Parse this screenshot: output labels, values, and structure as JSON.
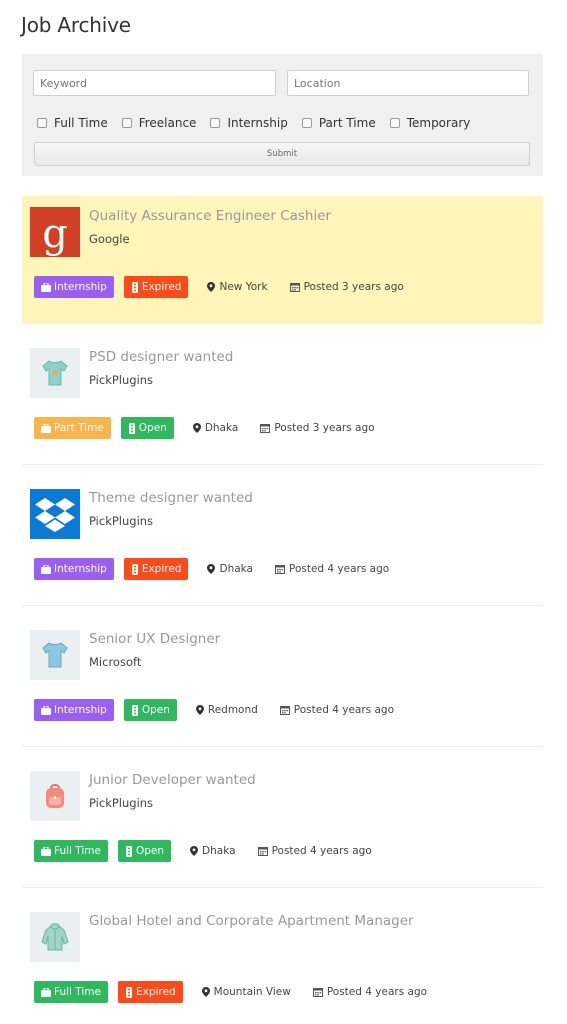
{
  "page": {
    "title": "Job Archive"
  },
  "filters": {
    "keyword_placeholder": "Keyword",
    "location_placeholder": "Location",
    "job_types": [
      "Full Time",
      "Freelance",
      "Internship",
      "Part Time",
      "Temporary"
    ],
    "submit_label": "Submit"
  },
  "colors": {
    "full_time": "#2fb85e",
    "internship": "#9b5ef2",
    "part_time": "#f7b54a",
    "open": "#2fb85e",
    "expired": "#fc4b19",
    "featured_bg": "#fdf5b9"
  },
  "jobs": [
    {
      "title": "Quality Assurance Engineer Cashier",
      "company": "Google",
      "type": "Internship",
      "status": "Expired",
      "location": "New York",
      "posted": "Posted 3 years ago",
      "featured": true,
      "logo": "google-logo"
    },
    {
      "title": "PSD designer wanted",
      "company": "PickPlugins",
      "type": "Part Time",
      "status": "Open",
      "location": "Dhaka",
      "posted": "Posted 3 years ago",
      "featured": false,
      "logo": "tshirt-logo"
    },
    {
      "title": "Theme designer wanted",
      "company": "PickPlugins",
      "type": "Internship",
      "status": "Expired",
      "location": "Dhaka",
      "posted": "Posted 4 years ago",
      "featured": false,
      "logo": "dropbox-logo"
    },
    {
      "title": "Senior UX Designer",
      "company": "Microsoft",
      "type": "Internship",
      "status": "Open",
      "location": "Redmond",
      "posted": "Posted 4 years ago",
      "featured": false,
      "logo": "tshirt-blue-logo"
    },
    {
      "title": "Junior Developer wanted",
      "company": "PickPlugins",
      "type": "Full Time",
      "status": "Open",
      "location": "Dhaka",
      "posted": "Posted 4 years ago",
      "featured": false,
      "logo": "backpack-logo"
    },
    {
      "title": "Global Hotel and Corporate Apartment Manager",
      "company": "",
      "type": "Full Time",
      "status": "Expired",
      "location": "Mountain View",
      "posted": "Posted 4 years ago",
      "featured": false,
      "logo": "hoodie-logo"
    }
  ]
}
